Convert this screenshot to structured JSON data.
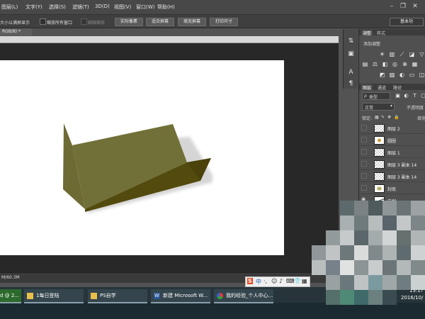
{
  "menubar": {
    "items": [
      "图层(L)",
      "文字(Y)",
      "选择(S)",
      "滤镜(T)",
      "3D(D)",
      "视图(V)",
      "窗口(W)",
      "帮助(H)"
    ]
  },
  "options": {
    "text_left": "大小以满屏显示",
    "zoom_all_label": "缩放所有窗口",
    "scrubby_label": "细微缩放",
    "actual_pixels": "实际像素",
    "fit_screen": "适合屏幕",
    "fill_screen": "填充屏幕",
    "print_size": "打印尺寸",
    "workspace": "基本功"
  },
  "document": {
    "tab": "RGB/8) *",
    "status": "M/60.3M"
  },
  "panels": {
    "adjust_tabs": [
      "调整",
      "样式"
    ],
    "add_adjustment": "添加调整",
    "layer_tabs": [
      "图层",
      "通道",
      "路径"
    ],
    "filter_kind": "类型",
    "blend_mode": "正常",
    "opacity_label": "不透明度",
    "lock_label": "锁定:",
    "fill_label": "填充"
  },
  "layers": [
    {
      "name": "图层 2",
      "visible": false,
      "thumb": "checker"
    },
    {
      "name": "圆圈",
      "visible": false,
      "thumb": "dot"
    },
    {
      "name": "图层 1",
      "visible": false,
      "thumb": "checker"
    },
    {
      "name": "图层 3 副本 14",
      "visible": false,
      "thumb": "checker"
    },
    {
      "name": "图层 3 副本 14",
      "visible": false,
      "thumb": "checker"
    },
    {
      "name": "封底",
      "visible": false,
      "thumb": "blob"
    },
    {
      "name": "正剑",
      "visible": true,
      "thumb": "stroke"
    }
  ],
  "ime": {
    "items": [
      "S",
      "中",
      "·,",
      "☺",
      "♪",
      "⌨",
      "👕",
      "▦"
    ]
  },
  "taskbar": {
    "tasks": [
      {
        "label": "d @ 2...",
        "icon": "photoshop-icon"
      },
      {
        "label": "1每日登陆",
        "icon": "folder-icon"
      },
      {
        "label": "PS自学",
        "icon": "folder-icon"
      },
      {
        "label": "新建 Microsoft W...",
        "icon": "word-icon"
      },
      {
        "label": "我的经验_个人中心...",
        "icon": "browser-icon"
      }
    ],
    "tray_ime": "中",
    "time": "13:1?",
    "date": "2016/10/"
  },
  "colors": {
    "shape_top": "#707038",
    "shape_side": "#534a0e",
    "shape_left": "#6e6a34",
    "taskbar": "#1b2a31"
  }
}
